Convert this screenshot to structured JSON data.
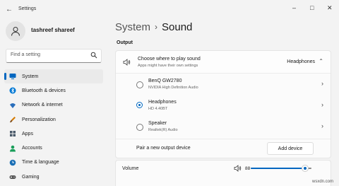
{
  "app": {
    "title": "Settings"
  },
  "user": {
    "name": "tashreef shareef"
  },
  "search": {
    "placeholder": "Find a setting"
  },
  "nav": {
    "items": [
      {
        "label": "System",
        "icon": "monitor-icon",
        "color": "#0067c0"
      },
      {
        "label": "Bluetooth & devices",
        "icon": "bluetooth-icon",
        "color": "#0078d4"
      },
      {
        "label": "Network & internet",
        "icon": "wifi-icon",
        "color": "#2a6ebb"
      },
      {
        "label": "Personalization",
        "icon": "brush-icon",
        "color": "#d47a00"
      },
      {
        "label": "Apps",
        "icon": "apps-icon",
        "color": "#4a5a6a"
      },
      {
        "label": "Accounts",
        "icon": "person-icon",
        "color": "#1a9e5a"
      },
      {
        "label": "Time & language",
        "icon": "globe-clock-icon",
        "color": "#1a6fb5"
      },
      {
        "label": "Gaming",
        "icon": "gamepad-icon",
        "color": "#555555"
      }
    ],
    "active_index": 0
  },
  "breadcrumb": {
    "section": "System",
    "separator": "›",
    "current": "Sound"
  },
  "output": {
    "section_label": "Output",
    "choose": {
      "title": "Choose where to play sound",
      "subtitle": "Apps might have their own settings",
      "value": "Headphones"
    },
    "devices": [
      {
        "name": "BenQ GW2780",
        "detail": "NVIDIA High Definition Audio",
        "selected": false
      },
      {
        "name": "Headphones",
        "detail": "HD 4.40BT",
        "selected": true
      },
      {
        "name": "Speaker",
        "detail": "Realtek(R) Audio",
        "selected": false
      }
    ],
    "pair": {
      "label": "Pair a new output device",
      "button": "Add device"
    }
  },
  "volume": {
    "label": "Volume",
    "value_text": "88",
    "level": 88
  },
  "watermark": "wsxdn.com",
  "accent": "#0067c0"
}
